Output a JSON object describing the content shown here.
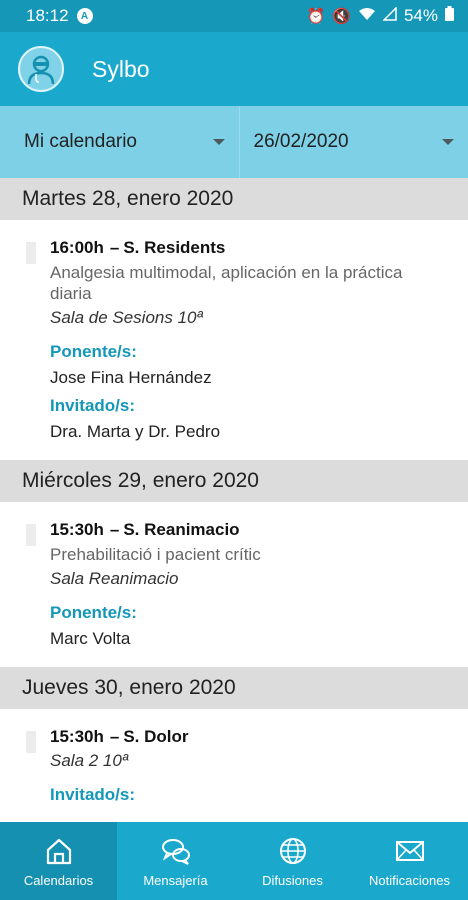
{
  "status": {
    "time": "18:12",
    "battery": "54%"
  },
  "app": {
    "title": "Sylbo"
  },
  "filters": {
    "calendar": "Mi calendario",
    "date": "26/02/2020"
  },
  "days": [
    {
      "title": "Martes 28, enero 2020",
      "event": {
        "time": "16:00h",
        "group": "S. Residents",
        "description": "Analgesia multimodal, aplicación en la práctica diaria",
        "room": "Sala de Sesions 10ª",
        "speaker_label": "Ponente/s:",
        "speaker": "Jose Fina Hernández",
        "guest_label": "Invitado/s:",
        "guest": "Dra. Marta y Dr. Pedro"
      }
    },
    {
      "title": "Miércoles 29, enero 2020",
      "event": {
        "time": "15:30h",
        "group": "S. Reanimacio",
        "description": "Prehabilitació i pacient crític",
        "room": "Sala Reanimacio",
        "speaker_label": "Ponente/s:",
        "speaker": "Marc Volta"
      }
    },
    {
      "title": "Jueves 30, enero 2020",
      "event": {
        "time": "15:30h",
        "group": "S. Dolor",
        "room": "Sala 2 10ª",
        "guest_label": "Invitado/s:"
      }
    }
  ],
  "tabs": [
    {
      "label": "Calendarios",
      "icon": "home-icon"
    },
    {
      "label": "Mensajería",
      "icon": "chat-bubbles-icon"
    },
    {
      "label": "Difusiones",
      "icon": "globe-icon"
    },
    {
      "label": "Notificaciones",
      "icon": "envelope-icon"
    }
  ],
  "colors": {
    "primary": "#1aa9cc",
    "status_bar": "#1597b8",
    "filter_bar": "#7dd0e6",
    "accent_text": "#1597b8",
    "day_header": "#dcdcdc"
  }
}
